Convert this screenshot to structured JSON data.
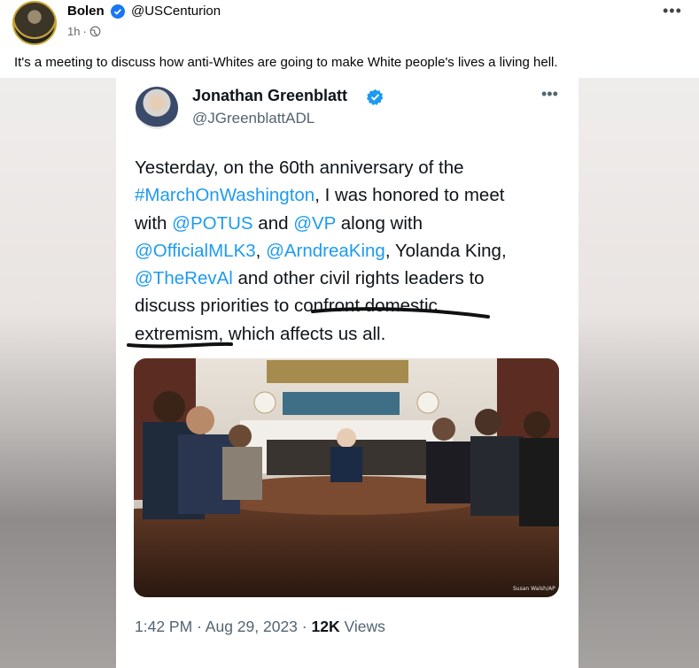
{
  "post": {
    "author_name": "Bolen",
    "author_handle": "@USCenturion",
    "time": "1h",
    "separator": "·",
    "text": "It's a meeting to discuss how anti-Whites are going to make White people's lives a living hell."
  },
  "tweet": {
    "name": "Jonathan Greenblatt",
    "handle": "@JGreenblattADL",
    "lines": [
      [
        "Yesterday, on the 60th anniversary of the"
      ],
      [
        "#MarchOnWashington",
        ", I was honored to meet"
      ],
      [
        "with ",
        "@POTUS",
        " and ",
        "@VP",
        " along with"
      ],
      [
        "@OfficialMLK3",
        ", ",
        "@ArndreaKing",
        ", Yolanda King,"
      ],
      [
        "@TheRevAl",
        " and other civil rights leaders to"
      ],
      [
        "discuss priorities to confront domestic"
      ],
      [
        "extremism, which affects us all."
      ]
    ],
    "time": "1:42 PM",
    "dot": "·",
    "date": "Aug 29, 2023",
    "views_count": "12K",
    "views_label": "Views",
    "photo_credit": "Susan Walsh/AP"
  },
  "colors": {
    "link": "#1d9bf0",
    "verified": "#1d9bf0",
    "facebook_verified": "#1877f2"
  },
  "icons": [
    "verified-icon",
    "globe-icon",
    "more-options-icon"
  ]
}
